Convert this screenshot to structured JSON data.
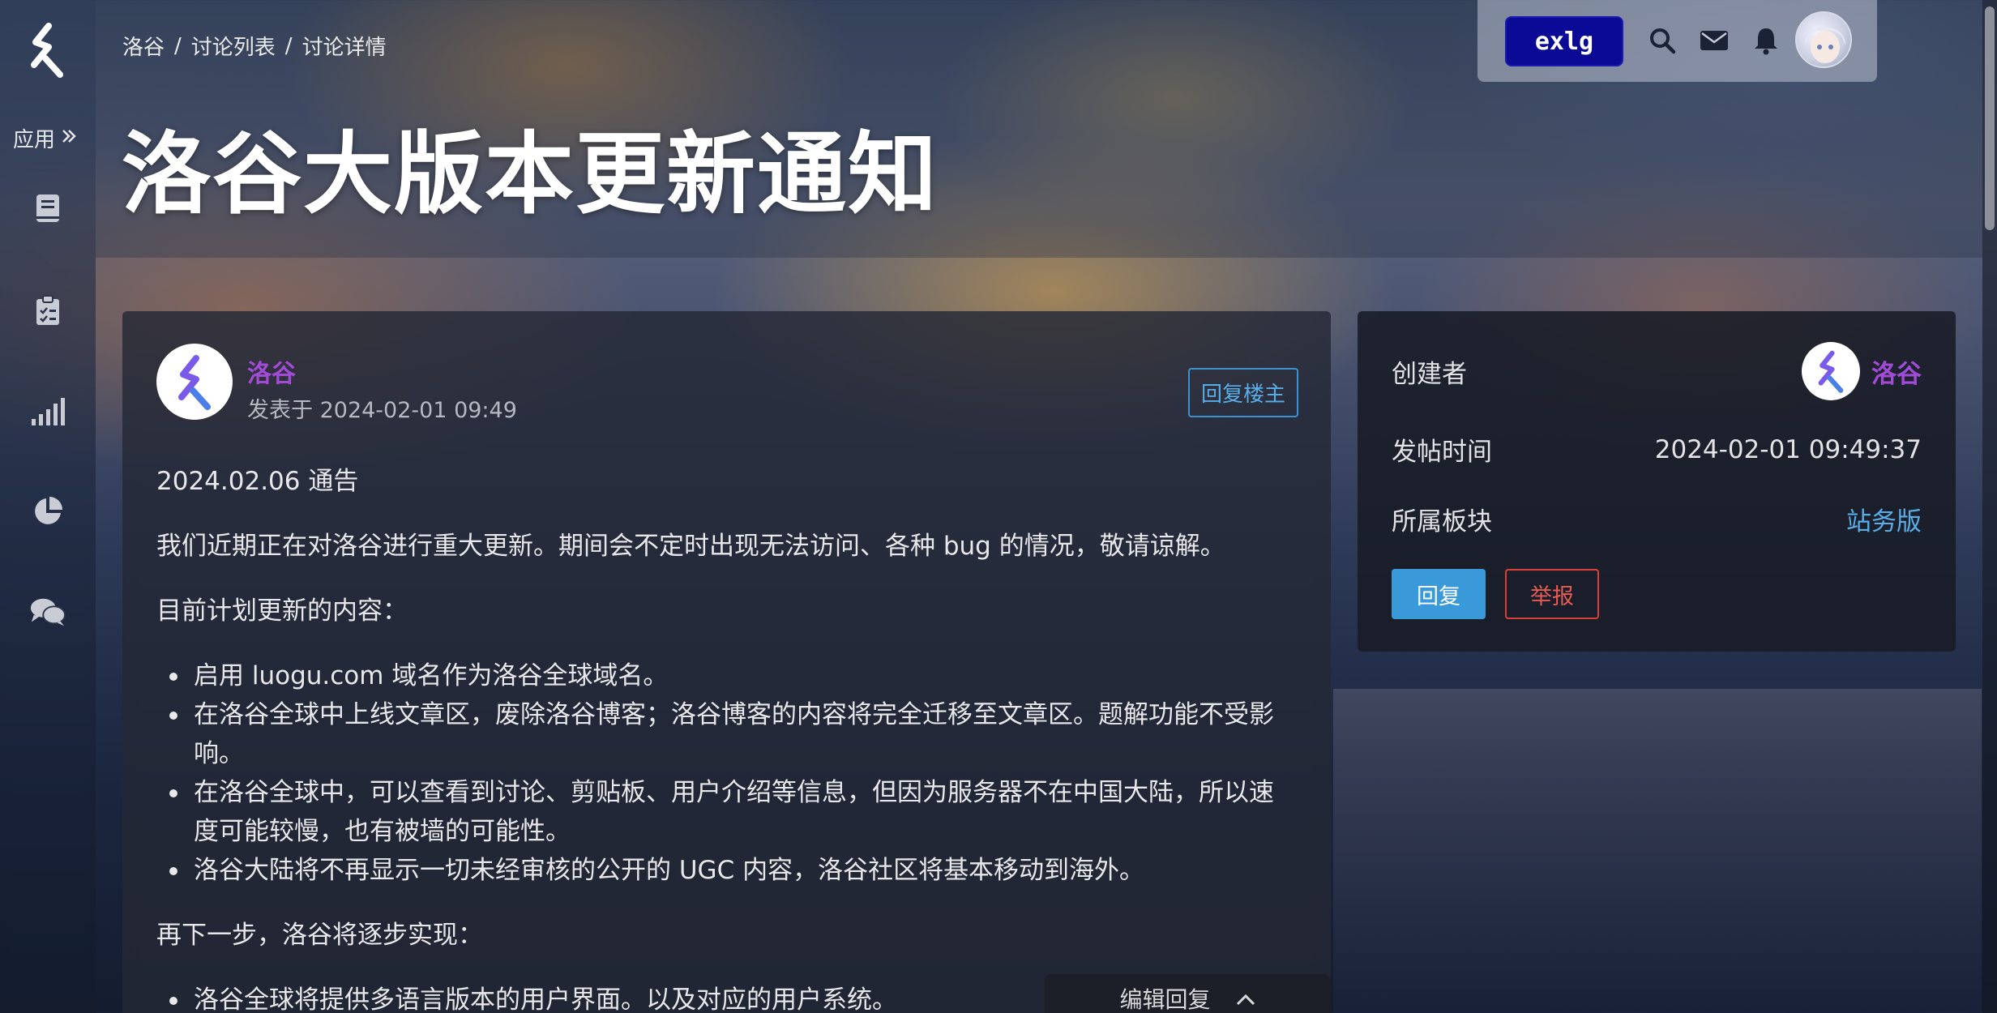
{
  "sidebar": {
    "apps_label": "应用",
    "icons": [
      "book-icon",
      "clipboard-check-icon",
      "signal-bars-icon",
      "pie-chart-icon",
      "chat-bubbles-icon"
    ]
  },
  "breadcrumb": [
    "洛谷",
    "讨论列表",
    "讨论详情"
  ],
  "breadcrumb_separator": "/",
  "page_title": "洛谷大版本更新通知",
  "userbox": {
    "exlg_label": "exlg",
    "icons": [
      "search-icon",
      "mail-icon",
      "bell-icon"
    ]
  },
  "post": {
    "author": "洛谷",
    "posted_at": "发表于 2024-02-01 09:49",
    "reply_op_label": "回复楼主",
    "heading": "2024.02.06 通告",
    "intro": "我们近期正在对洛谷进行重大更新。期间会不定时出现无法访问、各种 bug 的情况，敬请谅解。",
    "plan_title": "目前计划更新的内容：",
    "plan_items": [
      "启用 luogu.com 域名作为洛谷全球域名。",
      "在洛谷全球中上线文章区，废除洛谷博客；洛谷博客的内容将完全迁移至文章区。题解功能不受影响。",
      "在洛谷全球中，可以查看到讨论、剪贴板、用户介绍等信息，但因为服务器不在中国大陆，所以速度可能较慢，也有被墙的可能性。",
      "洛谷大陆将不再显示一切未经审核的公开的 UGC 内容，洛谷社区将基本移动到海外。"
    ],
    "next_title": "再下一步，洛谷将逐步实现：",
    "next_items": [
      "洛谷全球将提供多语言版本的用户界面。以及对应的用户系统。"
    ]
  },
  "edit_reply_label": "编辑回复",
  "info": {
    "creator_label": "创建者",
    "creator_name": "洛谷",
    "time_label": "发帖时间",
    "time_value": "2024-02-01 09:49:37",
    "board_label": "所属板块",
    "board_value": "站务版",
    "reply_button": "回复",
    "report_button": "举报"
  },
  "colors": {
    "accent_blue": "#3a9ad9",
    "user_purple": "#a24bd8",
    "report_red": "#d9413a",
    "exlg_navy": "#0a0a96"
  }
}
